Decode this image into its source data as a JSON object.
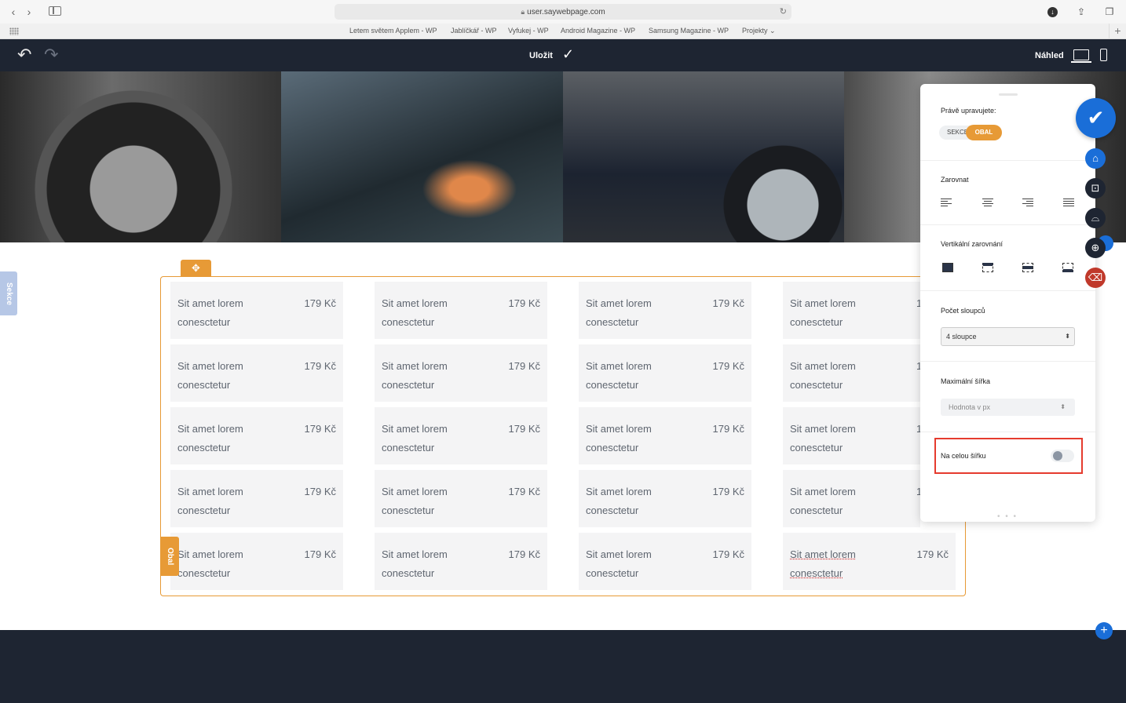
{
  "browser": {
    "url": "user.saywebpage.com",
    "bookmarks": [
      "Letem světem Applem - WP",
      "Jablíčkář - WP",
      "Vyfukej - WP",
      "Android Magazine - WP",
      "Samsung Magazine - WP",
      "Projekty ⌄"
    ]
  },
  "editor": {
    "save_label": "Uložit",
    "preview_label": "Náhled"
  },
  "sekce_tab": "Sekce",
  "obal_tab": "Obal",
  "products": {
    "rows": [
      [
        {
          "name": "Sit amet lorem conesctetur",
          "price": "179 Kč"
        },
        {
          "name": "Sit amet lorem conesctetur",
          "price": "179 Kč"
        },
        {
          "name": "Sit amet lorem conesctetur",
          "price": "179 Kč"
        },
        {
          "name": "Sit amet lorem conesctetur",
          "price": "1"
        }
      ],
      [
        {
          "name": "Sit amet lorem conesctetur",
          "price": "179 Kč"
        },
        {
          "name": "Sit amet lorem conesctetur",
          "price": "179 Kč"
        },
        {
          "name": "Sit amet lorem conesctetur",
          "price": "179 Kč"
        },
        {
          "name": "Sit amet lorem conesctetur",
          "price": "1"
        }
      ],
      [
        {
          "name": "Sit amet lorem conesctetur",
          "price": "179 Kč"
        },
        {
          "name": "Sit amet lorem conesctetur",
          "price": "179 Kč"
        },
        {
          "name": "Sit amet lorem conesctetur",
          "price": "179 Kč"
        },
        {
          "name": "Sit amet lorem conesctetur",
          "price": "1"
        }
      ],
      [
        {
          "name": "Sit amet lorem conesctetur",
          "price": "179 Kč"
        },
        {
          "name": "Sit amet lorem conesctetur",
          "price": "179 Kč"
        },
        {
          "name": "Sit amet lorem conesctetur",
          "price": "179 Kč"
        },
        {
          "name": "Sit amet lorem conesctetur",
          "price": "1"
        }
      ],
      [
        {
          "name": "Sit amet lorem conesctetur",
          "price": "179 Kč"
        },
        {
          "name": "Sit amet lorem conesctetur",
          "price": "179 Kč"
        },
        {
          "name": "Sit amet lorem conesctetur",
          "price": "179 Kč"
        },
        {
          "name": "Sit amet lorem conesctetur",
          "price": "179 Kč"
        }
      ]
    ]
  },
  "panel": {
    "editing_label": "Právě upravujete:",
    "chip_section": "SEKCE",
    "chip_wrapper": "OBAL",
    "align_label": "Zarovnat",
    "valign_label": "Vertikální zarovnání",
    "columns_label": "Počet sloupců",
    "columns_value": "4 sloupce",
    "max_width_label": "Maximální šířka",
    "max_width_placeholder": "Hodnota v px",
    "full_width_label": "Na celou šířku",
    "full_width_on": false
  },
  "colors": {
    "accent_orange": "#e79a36",
    "accent_blue": "#1a6ed8",
    "toolbar_dark": "#1e2532",
    "highlight_red": "#e53b2e",
    "delete_red": "#c0392b"
  },
  "icons": {
    "side_buttons": [
      "home-icon",
      "focus-icon",
      "shirt-icon",
      "add-section-icon",
      "delete-icon"
    ]
  }
}
